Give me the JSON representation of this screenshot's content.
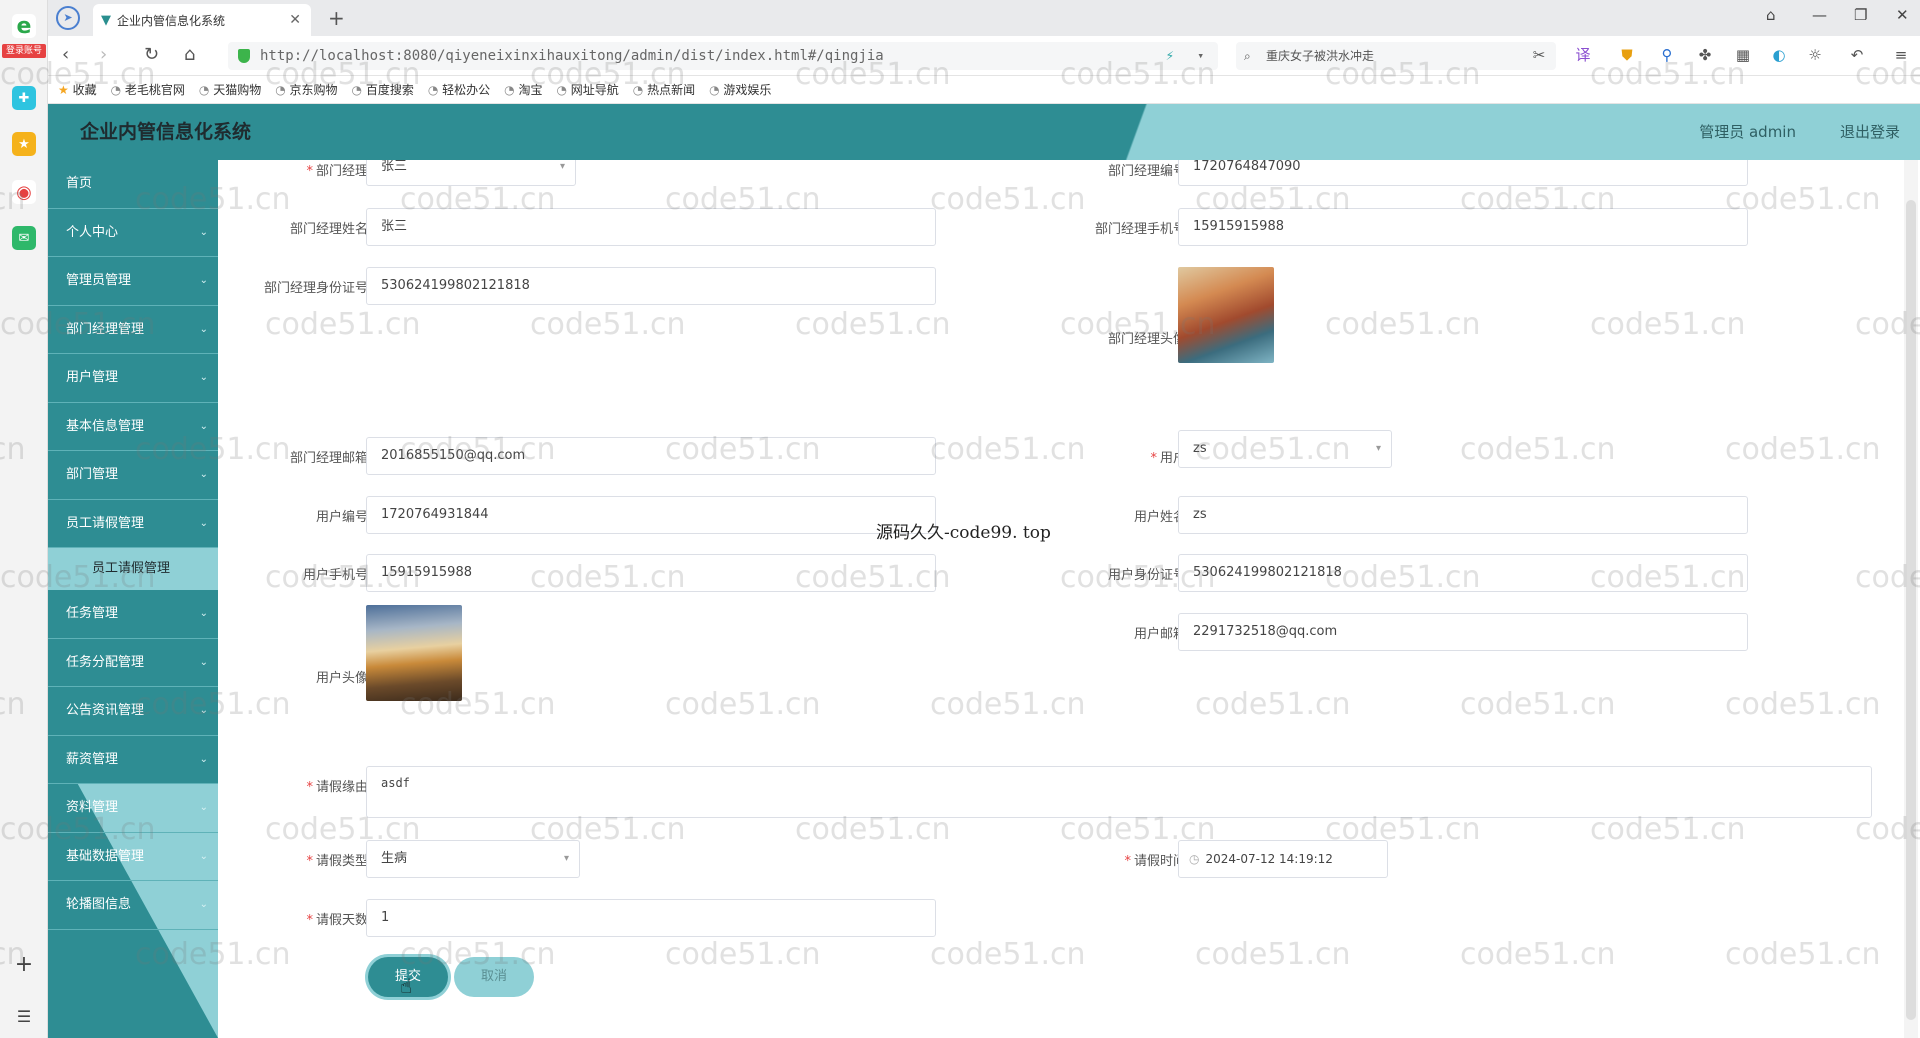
{
  "browser": {
    "tab_title": "企业内管信息化系统",
    "url": "http://localhost:8080/qiyeneixinxihauxitong/admin/dist/index.html#/qingjia",
    "search_text": "重庆女子被洪水冲走",
    "side_badge": "登录账号",
    "bookmarks": [
      "收藏",
      "老毛桃官网",
      "天猫购物",
      "京东购物",
      "百度搜索",
      "轻松办公",
      "淘宝",
      "网址导航",
      "热点新闻",
      "游戏娱乐"
    ]
  },
  "header": {
    "title": "企业内管信息化系统",
    "admin": "管理员 admin",
    "logout": "退出登录"
  },
  "sidebar": {
    "items": [
      {
        "label": "首页"
      },
      {
        "label": "个人中心"
      },
      {
        "label": "管理员管理"
      },
      {
        "label": "部门经理管理"
      },
      {
        "label": "用户管理"
      },
      {
        "label": "基本信息管理"
      },
      {
        "label": "部门管理"
      },
      {
        "label": "员工请假管理"
      }
    ],
    "active_sub": "员工请假管理",
    "items_after": [
      {
        "label": "任务管理"
      },
      {
        "label": "任务分配管理"
      },
      {
        "label": "公告资讯管理"
      },
      {
        "label": "薪资管理"
      },
      {
        "label": "资料管理"
      },
      {
        "label": "基础数据管理"
      },
      {
        "label": "轮播图信息"
      }
    ]
  },
  "form": {
    "manager_label": "部门经理",
    "manager_value": "张三",
    "manager_no_label": "部门经理编号",
    "manager_no_value": "1720764847090",
    "manager_name_label": "部门经理姓名",
    "manager_name_value": "张三",
    "manager_phone_label": "部门经理手机号",
    "manager_phone_value": "15915915988",
    "manager_id_label": "部门经理身份证号",
    "manager_id_value": "530624199802121818",
    "manager_avatar_label": "部门经理头像",
    "manager_email_label": "部门经理邮箱",
    "manager_email_value": "2016855150@qq.com",
    "user_label": "用户",
    "user_value": "zs",
    "user_no_label": "用户编号",
    "user_no_value": "1720764931844",
    "user_name_label": "用户姓名",
    "user_name_value": "zs",
    "user_phone_label": "用户手机号",
    "user_phone_value": "15915915988",
    "user_id_label": "用户身份证号",
    "user_id_value": "530624199802121818",
    "user_avatar_label": "用户头像",
    "user_email_label": "用户邮箱",
    "user_email_value": "2291732518@qq.com",
    "reason_label": "请假缘由",
    "reason_value": "asdf",
    "type_label": "请假类型",
    "type_value": "生病",
    "time_label": "请假时间",
    "time_value": "2024-07-12 14:19:12",
    "days_label": "请假天数",
    "days_value": "1",
    "submit": "提交",
    "cancel": "取消"
  },
  "overlay": "源码久久-code99. top",
  "watermark": "code51.cn",
  "colors": {
    "primary": "#2e8d93",
    "light": "#8fd0d6"
  }
}
